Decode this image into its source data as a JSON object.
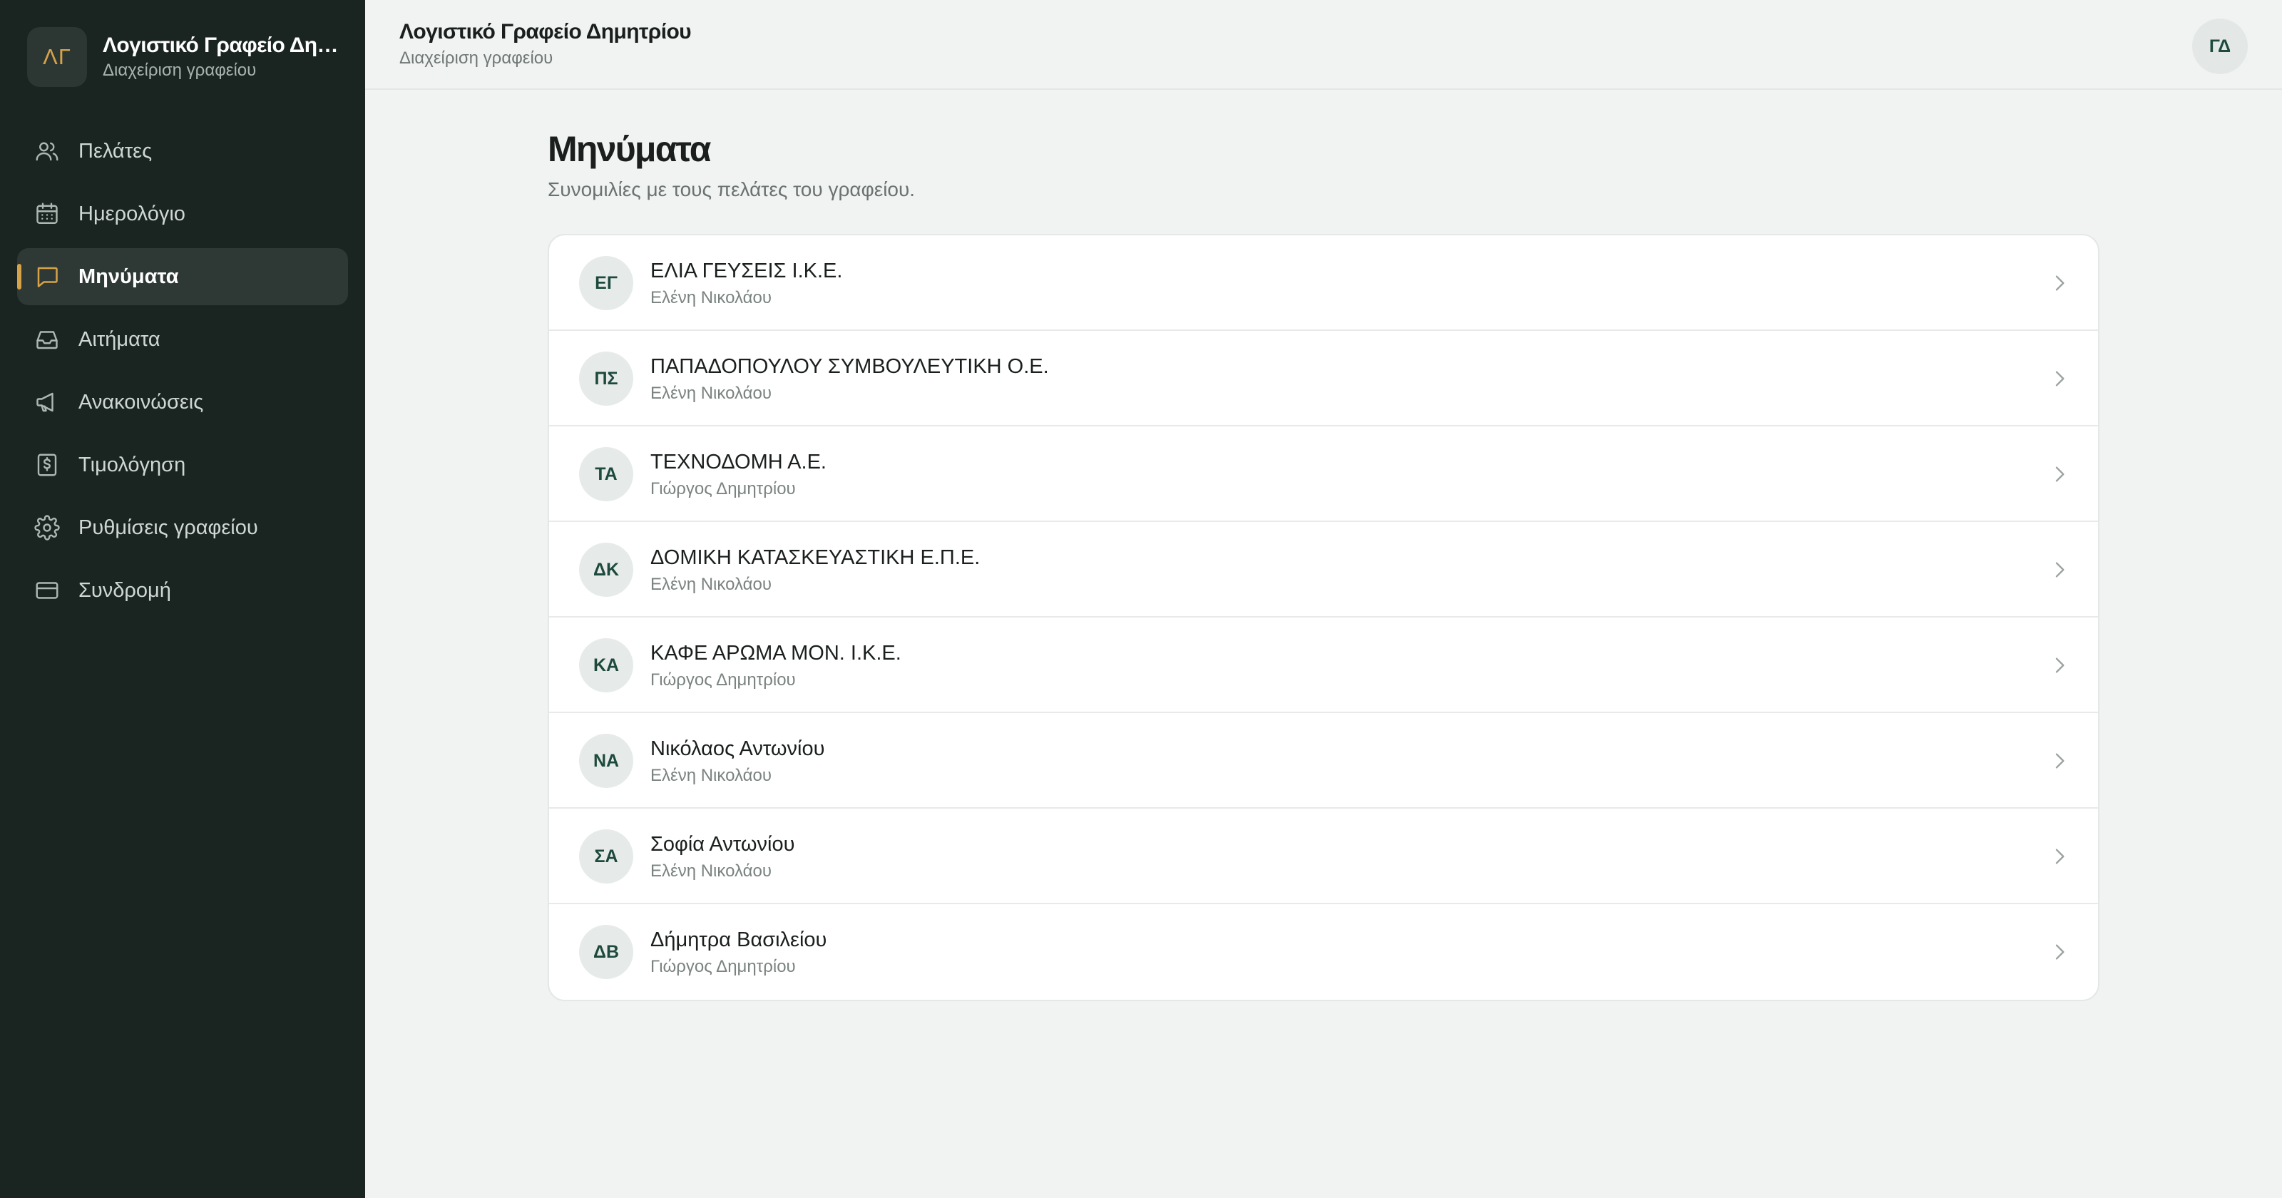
{
  "sidebar": {
    "logo_initials": "ΛΓ",
    "title": "Λογιστικό Γραφείο Δημητρίου",
    "subtitle": "Διαχείριση γραφείου",
    "items": [
      {
        "label": "Πελάτες",
        "icon": "users-icon",
        "active": false
      },
      {
        "label": "Ημερολόγιο",
        "icon": "calendar-icon",
        "active": false
      },
      {
        "label": "Μηνύματα",
        "icon": "message-icon",
        "active": true
      },
      {
        "label": "Αιτήματα",
        "icon": "inbox-icon",
        "active": false
      },
      {
        "label": "Ανακοινώσεις",
        "icon": "megaphone-icon",
        "active": false
      },
      {
        "label": "Τιμολόγηση",
        "icon": "invoice-icon",
        "active": false
      },
      {
        "label": "Ρυθμίσεις γραφείου",
        "icon": "gear-icon",
        "active": false
      },
      {
        "label": "Συνδρομή",
        "icon": "credit-card-icon",
        "active": false
      }
    ]
  },
  "header": {
    "title": "Λογιστικό Γραφείο Δημητρίου",
    "subtitle": "Διαχείριση γραφείου",
    "user_initials": "ΓΔ"
  },
  "main": {
    "title": "Μηνύματα",
    "subtitle": "Συνομιλίες με τους πελάτες του γραφείου.",
    "conversations": [
      {
        "initials": "ΕΓ",
        "name": "ΕΛΙΑ ΓΕΥΣΕΙΣ Ι.Κ.Ε.",
        "assignee": "Ελένη Νικολάου"
      },
      {
        "initials": "ΠΣ",
        "name": "ΠΑΠΑΔΟΠΟΥΛΟΥ ΣΥΜΒΟΥΛΕΥΤΙΚΗ Ο.Ε.",
        "assignee": "Ελένη Νικολάου"
      },
      {
        "initials": "ΤΑ",
        "name": "ΤΕΧΝΟΔΟΜΗ Α.Ε.",
        "assignee": "Γιώργος Δημητρίου"
      },
      {
        "initials": "ΔΚ",
        "name": "ΔΟΜΙΚΗ ΚΑΤΑΣΚΕΥΑΣΤΙΚΗ Ε.Π.Ε.",
        "assignee": "Ελένη Νικολάου"
      },
      {
        "initials": "ΚΑ",
        "name": "ΚΑΦΕ ΑΡΩΜΑ ΜΟΝ. Ι.Κ.Ε.",
        "assignee": "Γιώργος Δημητρίου"
      },
      {
        "initials": "ΝΑ",
        "name": "Νικόλαος Αντωνίου",
        "assignee": "Ελένη Νικολάου"
      },
      {
        "initials": "ΣΑ",
        "name": "Σοφία Αντωνίου",
        "assignee": "Ελένη Νικολάου"
      },
      {
        "initials": "ΔΒ",
        "name": "Δήμητρα Βασιλείου",
        "assignee": "Γιώργος Δημητρίου"
      }
    ]
  },
  "colors": {
    "sidebar_bg": "#1a2421",
    "accent": "#d6a24a",
    "page_bg": "#f1f3f2",
    "avatar_text": "#1e4a3e"
  }
}
